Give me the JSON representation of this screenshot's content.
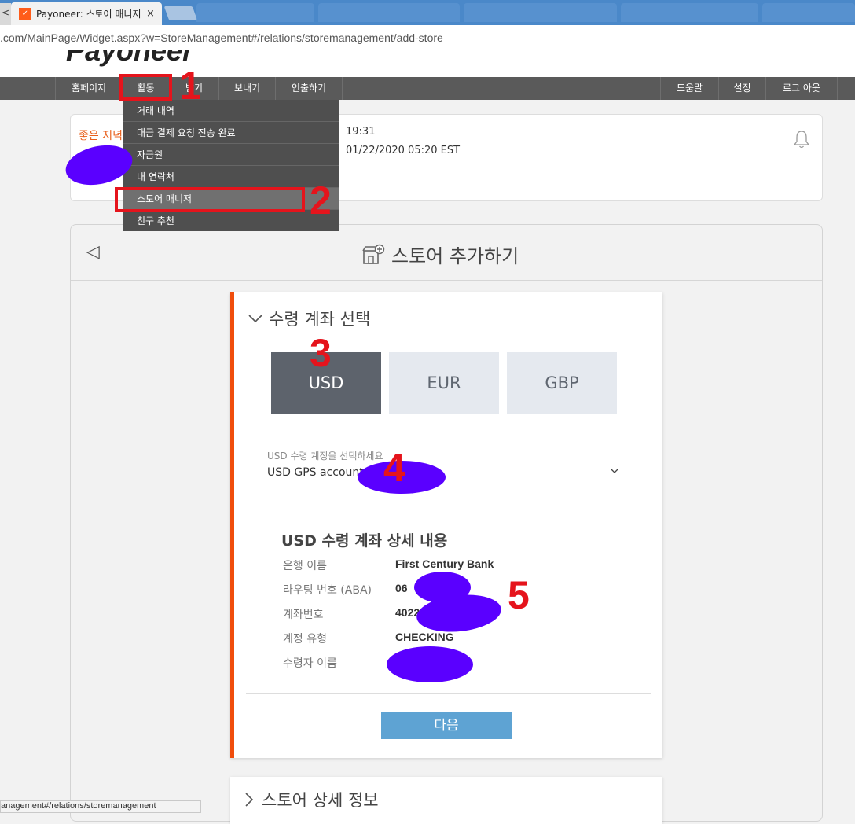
{
  "browser": {
    "tab_edge_label": "<",
    "tab_title": "Payoneer: 스토어 매니저",
    "tab_close": "×",
    "url": ".com/MainPage/Widget.aspx?w=StoreManagement#/relations/storemanagement/add-store"
  },
  "header": {
    "logo_text": "Payoneer",
    "nav_left": [
      "홈페이지",
      "활동",
      "받기",
      "보내기",
      "인출하기"
    ],
    "nav_right": [
      "도움말",
      "설정",
      "로그 아웃"
    ]
  },
  "dropdown": {
    "items": [
      "거래 내역",
      "대금 결제 요청 전송 완료",
      "자금원",
      "내 연락처",
      "스토어 매니저",
      "친구 추천"
    ]
  },
  "notice": {
    "greeting": "좋은 저녁",
    "time": "19:31",
    "date": "01/22/2020 05:20 EST"
  },
  "main": {
    "title": "스토어 추가하기",
    "section_title": "수령 계좌 선택",
    "currencies": [
      "USD",
      "EUR",
      "GBP"
    ],
    "selected_currency": "USD",
    "select_label": "USD 수령 계정을 선택하세요",
    "select_value": "USD GPS account",
    "details_title": "USD 수령 계좌 상세 내용",
    "details": [
      {
        "label": "은행 이름",
        "value": "First Century Bank"
      },
      {
        "label": "라우팅 번호 (ABA)",
        "value": "06"
      },
      {
        "label": "계좌번호",
        "value": "4022"
      },
      {
        "label": "계정 유형",
        "value": "CHECKING"
      },
      {
        "label": "수령자 이름",
        "value": ""
      }
    ],
    "next_button": "다음",
    "section2_title": "스토어 상세 정보"
  },
  "status_bar": "anagement#/relations/storemanagement",
  "annotations": {
    "numbers": [
      "1",
      "2",
      "3",
      "4",
      "5"
    ],
    "color": "#e5141c",
    "redaction_color": "#5a00ff"
  },
  "colors": {
    "brand_orange": "#f04d0c",
    "nav_bg": "#5a5a5a",
    "next_button": "#5ea3d3",
    "selected_currency_bg": "#5d636c"
  }
}
